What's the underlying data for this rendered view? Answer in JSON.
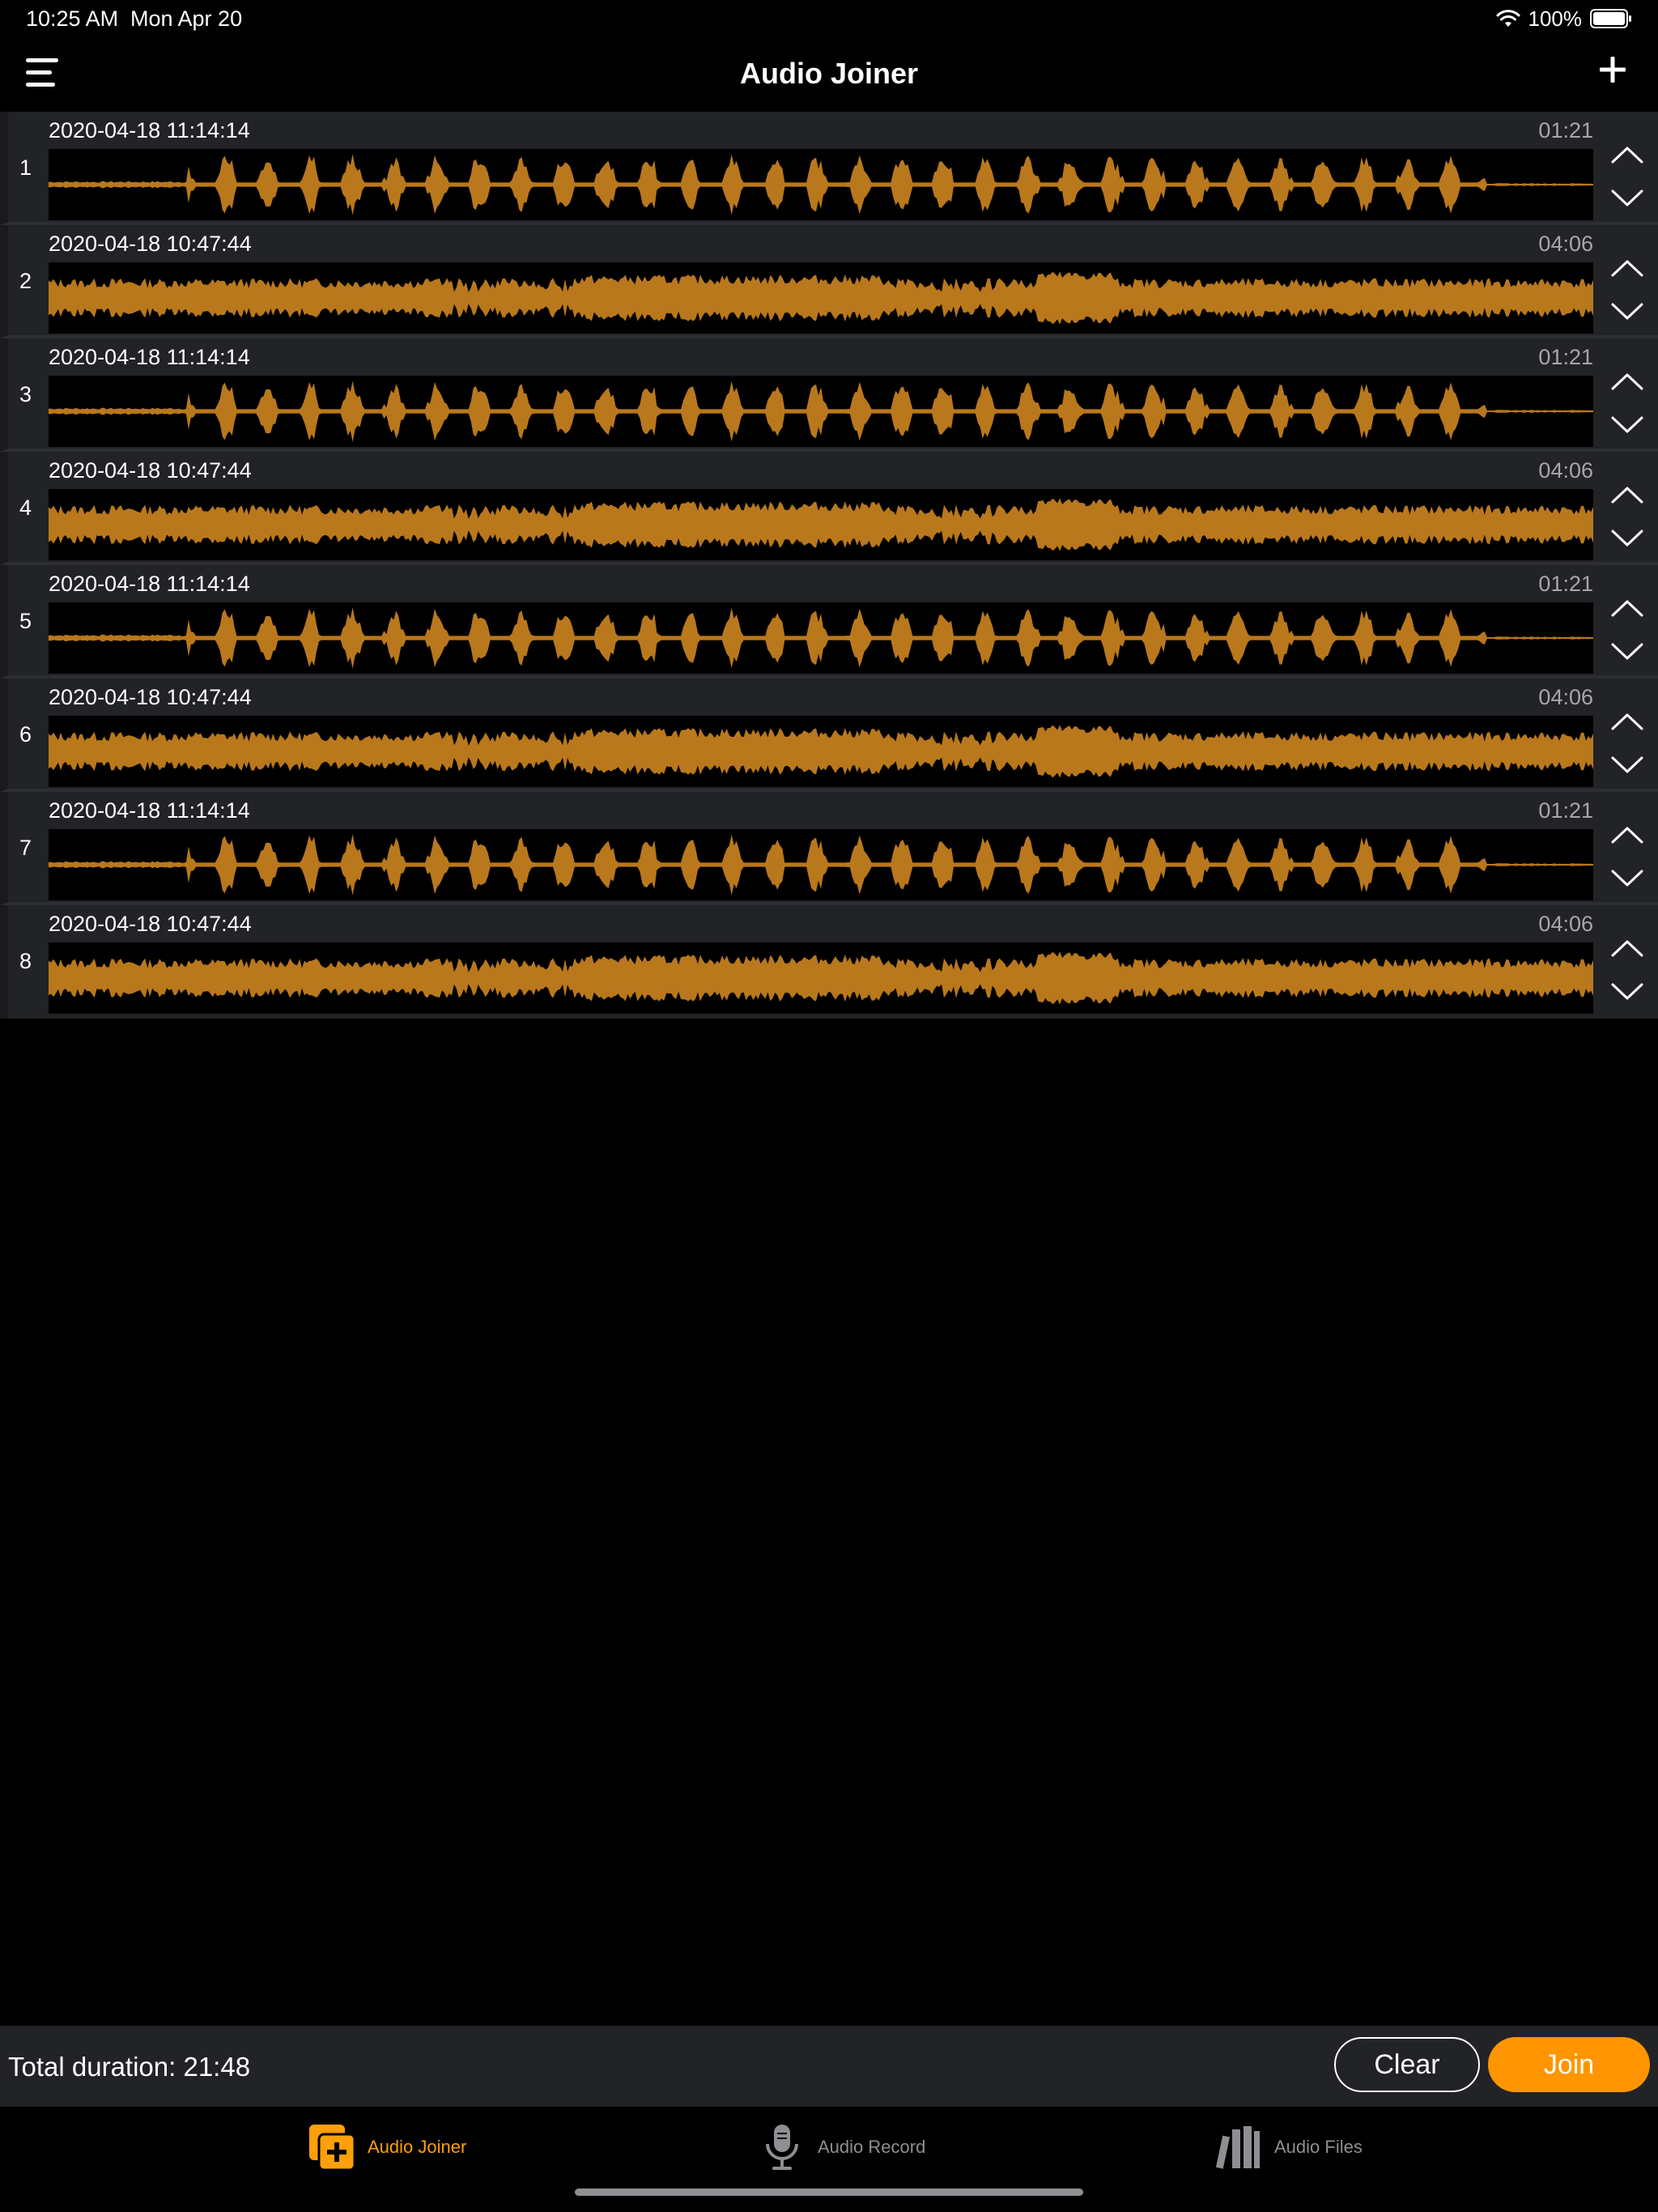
{
  "status_bar": {
    "time": "10:25 AM",
    "date": "Mon Apr 20",
    "battery": "100%",
    "icons": [
      "wifi-icon",
      "battery-icon"
    ]
  },
  "nav": {
    "title": "Audio Joiner",
    "menu_icon": "hamburger-menu-icon",
    "add_icon": "plus-icon"
  },
  "tracks": [
    {
      "index": "1",
      "name": "2020-04-18 11:14:14",
      "duration": "01:21",
      "pattern": "speech"
    },
    {
      "index": "2",
      "name": "2020-04-18 10:47:44",
      "duration": "04:06",
      "pattern": "music"
    },
    {
      "index": "3",
      "name": "2020-04-18 11:14:14",
      "duration": "01:21",
      "pattern": "speech"
    },
    {
      "index": "4",
      "name": "2020-04-18 10:47:44",
      "duration": "04:06",
      "pattern": "music"
    },
    {
      "index": "5",
      "name": "2020-04-18 11:14:14",
      "duration": "01:21",
      "pattern": "speech"
    },
    {
      "index": "6",
      "name": "2020-04-18 10:47:44",
      "duration": "04:06",
      "pattern": "music"
    },
    {
      "index": "7",
      "name": "2020-04-18 11:14:14",
      "duration": "01:21",
      "pattern": "speech"
    },
    {
      "index": "8",
      "name": "2020-04-18 10:47:44",
      "duration": "04:06",
      "pattern": "music"
    }
  ],
  "track_icons": {
    "up": "chevron-up-icon",
    "down": "chevron-down-icon"
  },
  "footer": {
    "total_duration": "Total duration: 21:48",
    "clear_label": "Clear",
    "join_label": "Join"
  },
  "tabs": [
    {
      "label": "Audio Joiner",
      "icon": "audio-joiner-icon",
      "active": true
    },
    {
      "label": "Audio Record",
      "icon": "microphone-icon",
      "active": false
    },
    {
      "label": "Audio Files",
      "icon": "library-icon",
      "active": false
    }
  ],
  "colors": {
    "background": "#000000",
    "row": "#222327",
    "waveform": "#b9781c",
    "accent": "#ff9500",
    "tab_inactive": "#8e8e93",
    "duration_text": "#a6a6ab"
  }
}
